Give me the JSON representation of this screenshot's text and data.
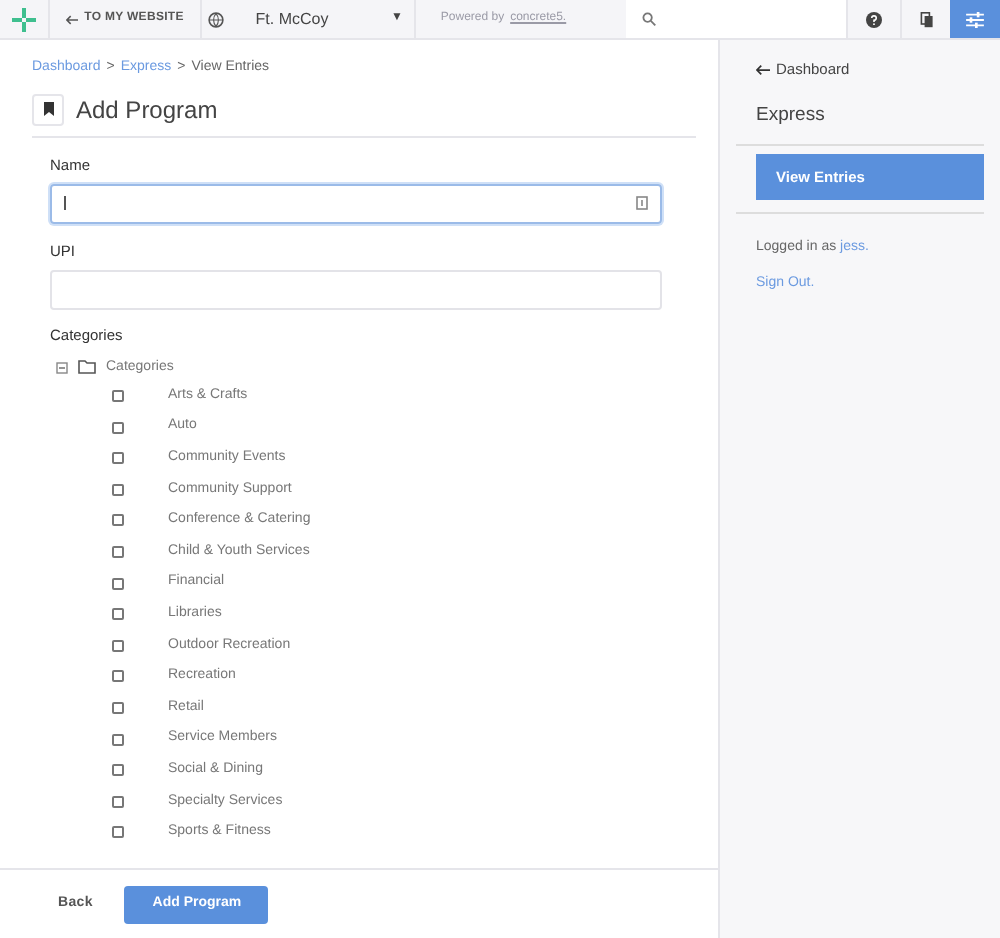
{
  "toolbar": {
    "back_link": "TO MY WEBSITE",
    "site_select": "Ft. McCoy",
    "site_caret": "▼",
    "powered_by": "Powered by",
    "powered_link": "concrete5."
  },
  "breadcrumb": [
    {
      "label": "Dashboard",
      "link": true
    },
    {
      "label": "Express",
      "link": true
    },
    {
      "label": "View Entries",
      "link": false
    }
  ],
  "separator": ">",
  "page_title": "Add Program",
  "form": {
    "name": {
      "label": "Name",
      "focused": true
    },
    "upi": {
      "label": "UPI",
      "focused": false
    },
    "categories": {
      "label": "Categories",
      "tree": {
        "label": "Categories",
        "expanded": true,
        "children": [
          {
            "label": "Arts & Crafts",
            "checked": false
          },
          {
            "label": "Auto",
            "checked": false
          },
          {
            "label": "Community Events",
            "checked": false
          },
          {
            "label": "Community Support",
            "checked": false
          },
          {
            "label": "Conference & Catering",
            "checked": false
          },
          {
            "label": "Child & Youth Services",
            "checked": false
          },
          {
            "label": "Financial",
            "checked": false
          },
          {
            "label": "Libraries",
            "checked": false
          },
          {
            "label": "Outdoor Recreation",
            "checked": false
          },
          {
            "label": "Recreation",
            "checked": false
          },
          {
            "label": "Retail",
            "checked": false
          },
          {
            "label": "Service Members",
            "checked": false
          },
          {
            "label": "Social & Dining",
            "checked": false
          },
          {
            "label": "Specialty Services",
            "checked": false
          },
          {
            "label": "Sports & Fitness",
            "checked": false
          }
        ]
      }
    }
  },
  "footer": {
    "back": "Back",
    "submit": "Add Program"
  },
  "sidebar": {
    "back": "Dashboard",
    "title": "Express",
    "items": [
      {
        "label": "View Entries",
        "selected": true
      }
    ],
    "logged_in": "Logged in as",
    "user": "jess.",
    "sign_out": "Sign Out."
  }
}
